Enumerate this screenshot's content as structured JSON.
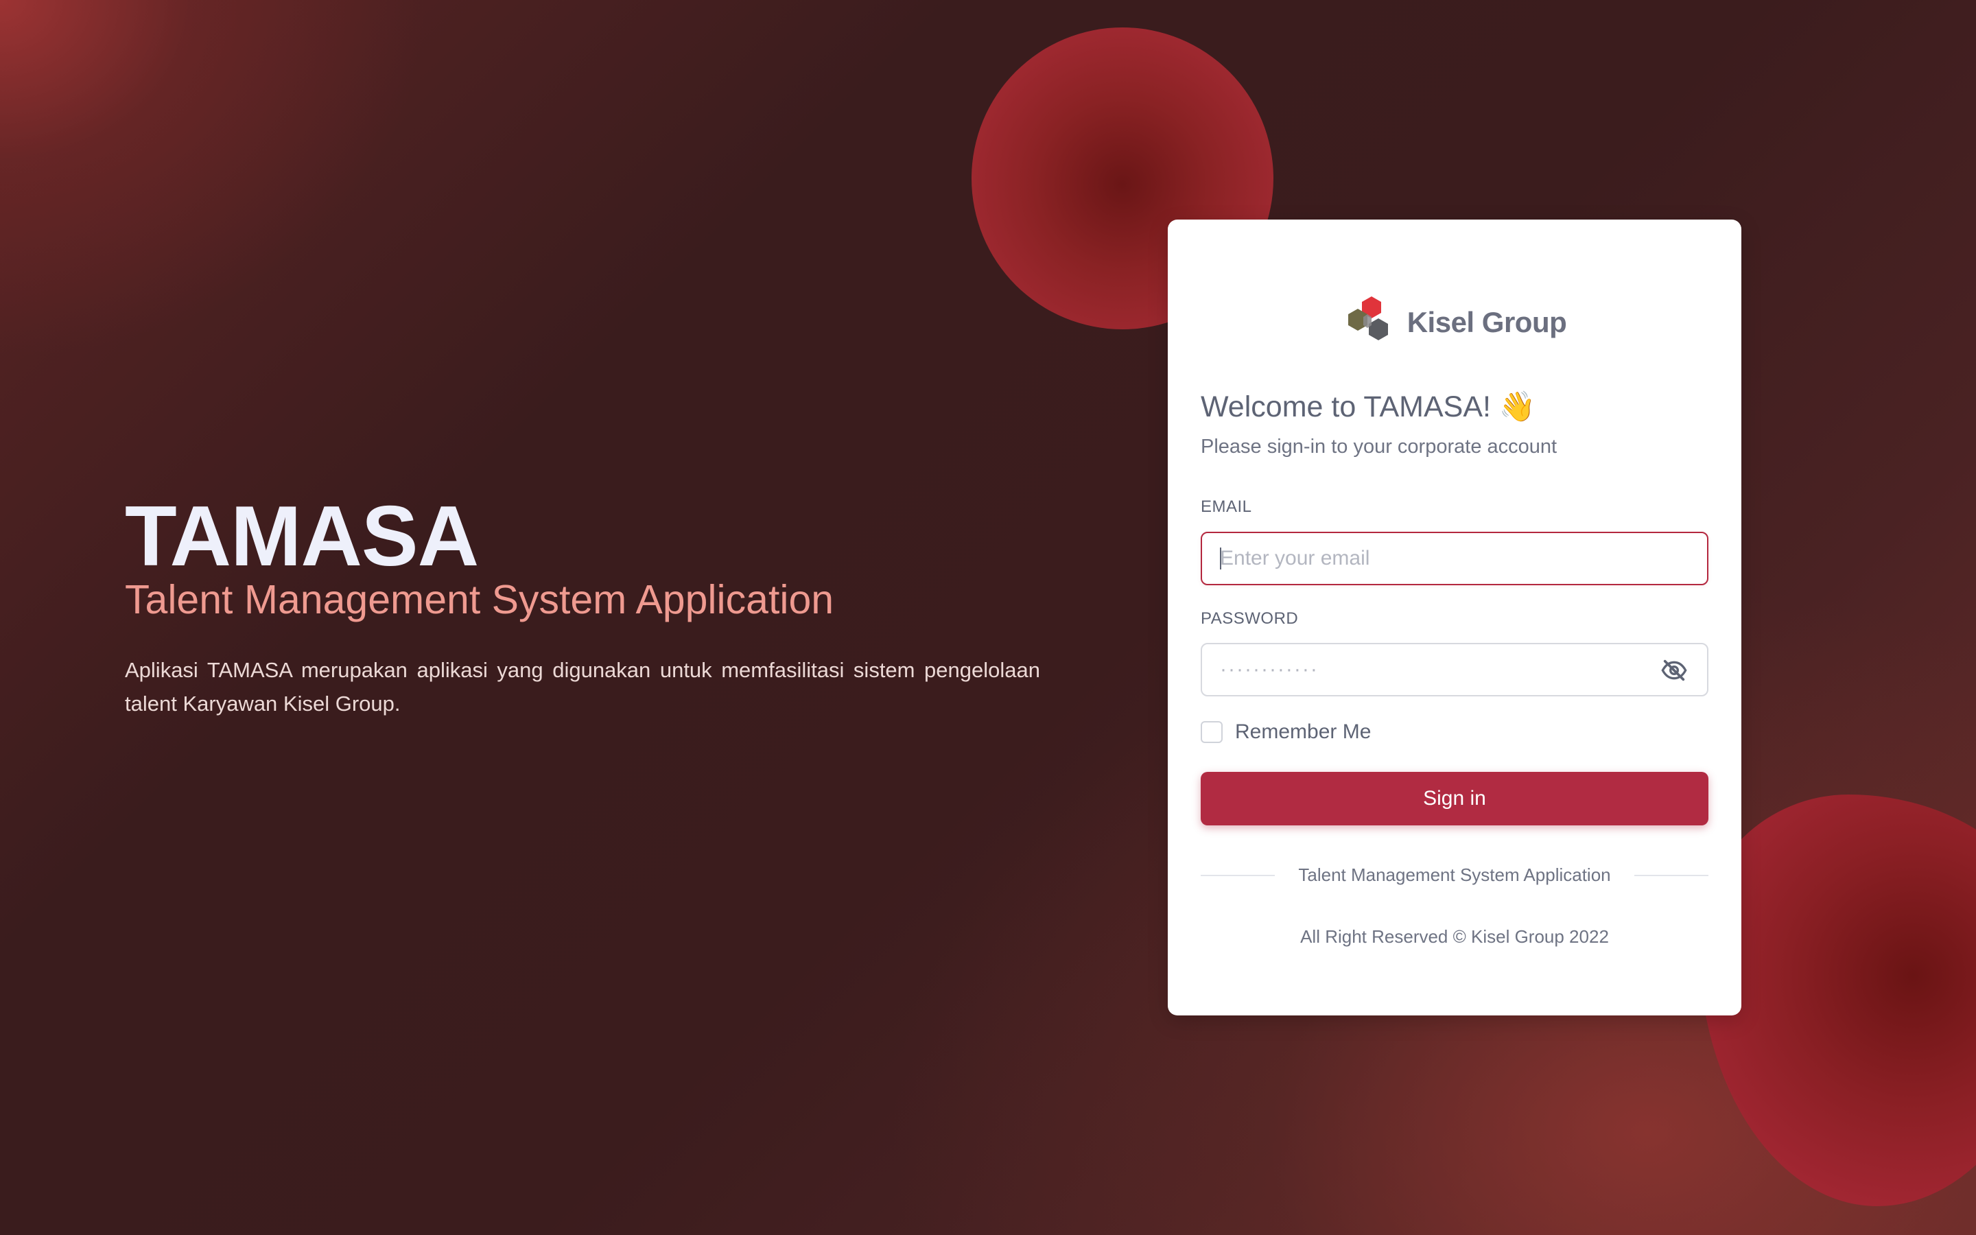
{
  "hero": {
    "title": "TAMASA",
    "subtitle": "Talent Management System Application",
    "description": "Aplikasi TAMASA merupakan aplikasi yang digunakan untuk memfasilitasi sistem pengelolaan talent Karyawan Kisel Group."
  },
  "card": {
    "logo_text": "Kisel Group",
    "logo_icon": "kisel-hexagon-logo",
    "welcome_title": "Welcome to TAMASA! 👋",
    "welcome_subtitle": "Please sign-in to your corporate account",
    "email": {
      "label": "EMAIL",
      "value": "",
      "placeholder": "Enter your email"
    },
    "password": {
      "label": "PASSWORD",
      "value": "",
      "placeholder": "············",
      "toggle_icon": "eye-off-icon"
    },
    "remember_label": "Remember Me",
    "remember_checked": false,
    "signin_label": "Sign in",
    "divider_text": "Talent Management System Application",
    "footer_text": "All Right Reserved © Kisel Group 2022"
  },
  "colors": {
    "accent": "#b12b42",
    "subtitle": "#ef9a90",
    "text_muted": "#6e7383"
  }
}
